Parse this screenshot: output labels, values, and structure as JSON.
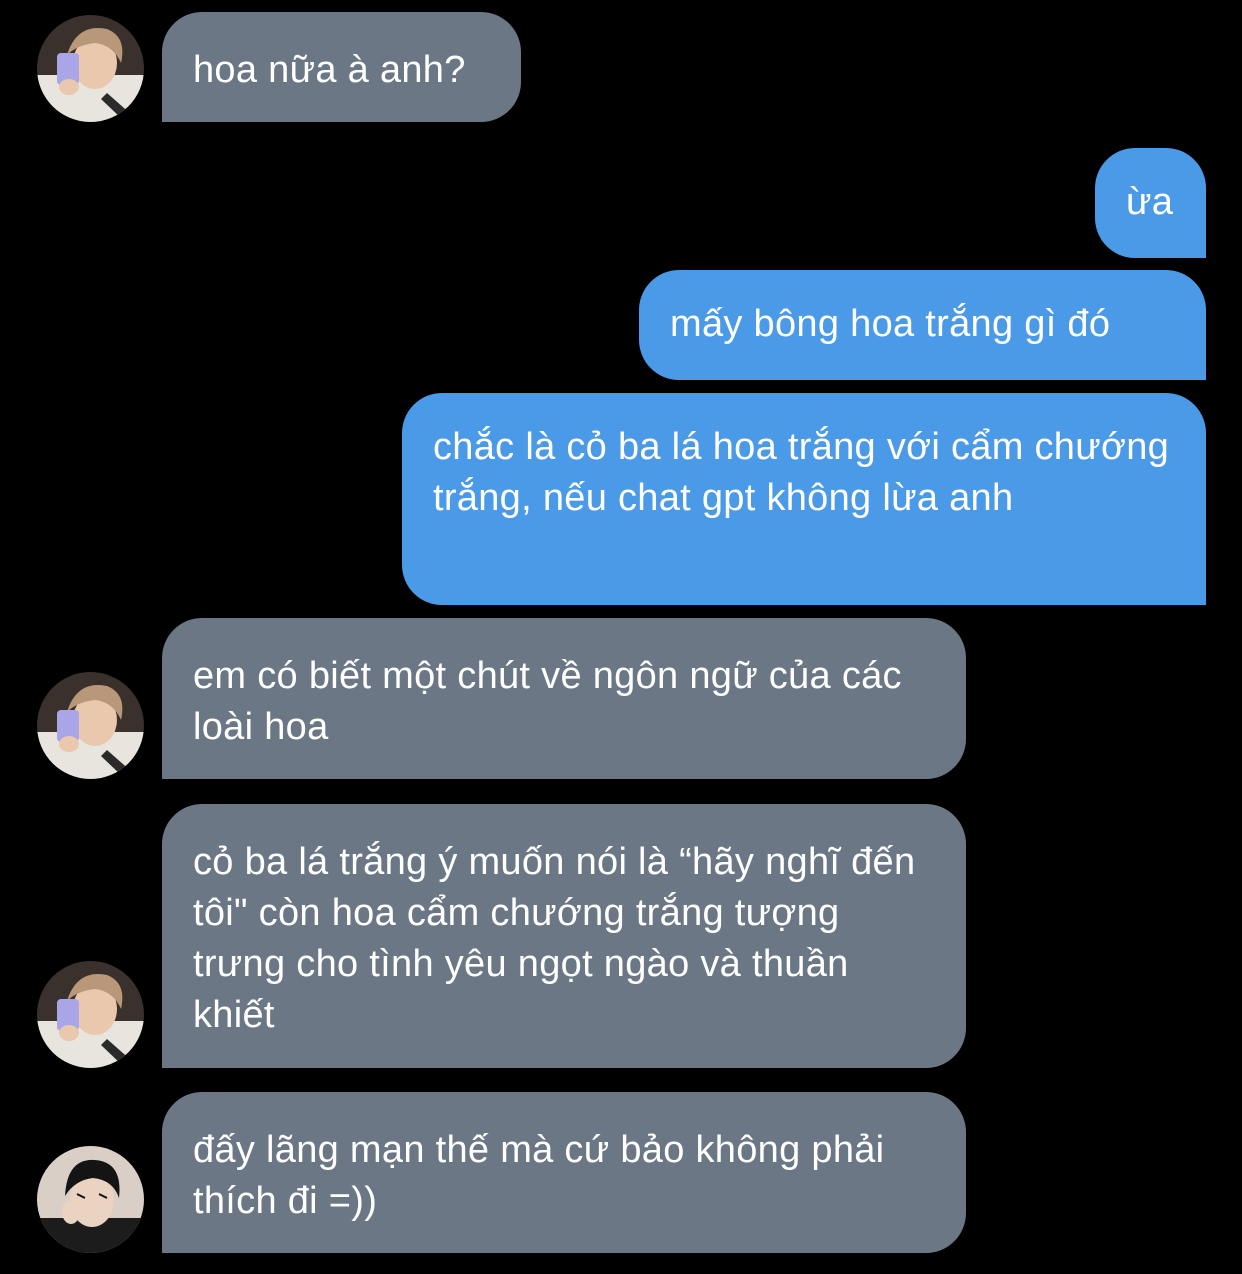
{
  "conversation": {
    "messages": [
      {
        "sender": "them",
        "avatar": "avatar-light-hair",
        "text": "hoa nữa à anh?"
      },
      {
        "sender": "me",
        "text": "ừa"
      },
      {
        "sender": "me",
        "text": "mấy bông hoa trắng gì đó"
      },
      {
        "sender": "me",
        "text": "chắc là cỏ ba lá hoa trắng với cẩm chướng trắng, nếu chat gpt không lừa anh"
      },
      {
        "sender": "them",
        "avatar": "avatar-light-hair",
        "text": "em có biết một chút về ngôn ngữ của các loài hoa"
      },
      {
        "sender": "them",
        "avatar": "avatar-light-hair",
        "text": "cỏ ba lá trắng ý muốn nói là “hãy nghĩ đến tôi\" còn hoa cẩm chướng trắng tượng trưng cho tình yêu ngọt ngào và thuần khiết"
      },
      {
        "sender": "them",
        "avatar": "avatar-dark-hair",
        "text": "đấy lãng mạn thế mà cứ bảo không phải thích đi =))"
      }
    ]
  },
  "colors": {
    "background": "#000000",
    "incoming_bubble": "#6b7785",
    "outgoing_bubble": "#4a9ae8",
    "text": "#ffffff"
  }
}
